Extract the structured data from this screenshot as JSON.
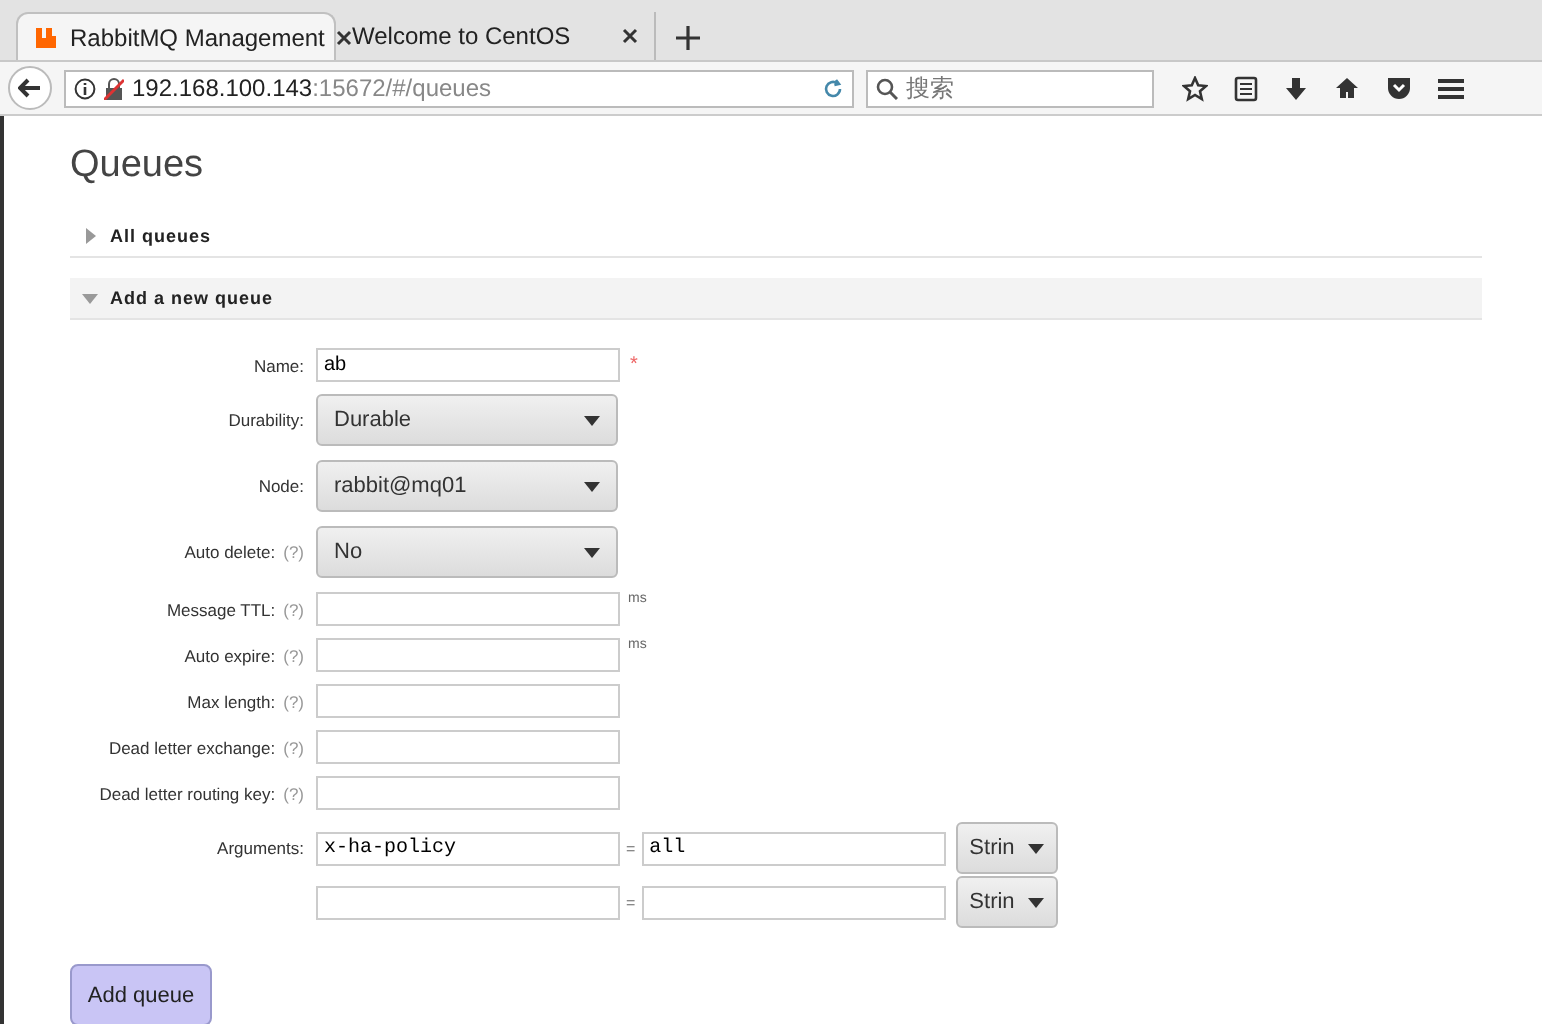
{
  "browser": {
    "tabs": [
      {
        "title": "RabbitMQ Management",
        "selected": true,
        "kind": "rabbit"
      },
      {
        "title": "Welcome to CentOS",
        "selected": false,
        "kind": "plain"
      }
    ],
    "url": {
      "host": "192.168.100.143",
      "rest": ":15672/#/queues"
    },
    "search": {
      "placeholder": "搜索"
    }
  },
  "page": {
    "title": "Queues",
    "sections": [
      {
        "label": "All queues",
        "expanded": false
      },
      {
        "label": "Add a new queue",
        "expanded": true
      }
    ],
    "fields": [
      {
        "kind": "text",
        "label": "Name:",
        "value": "ab",
        "required": true,
        "required_mark": "*"
      },
      {
        "kind": "select",
        "label": "Durability:",
        "value": "Durable"
      },
      {
        "kind": "select",
        "label": "Node:",
        "value": "rabbit@mq01"
      },
      {
        "kind": "select",
        "label": "Auto delete:",
        "help": "(?)",
        "value": "No"
      },
      {
        "kind": "text",
        "label": "Message TTL:",
        "help": "(?)",
        "unit": "ms"
      },
      {
        "kind": "text",
        "label": "Auto expire:",
        "help": "(?)",
        "unit": "ms"
      },
      {
        "kind": "text",
        "label": "Max length:",
        "help": "(?)"
      },
      {
        "kind": "text",
        "label": "Dead letter exchange:",
        "help": "(?)"
      },
      {
        "kind": "text",
        "label": "Dead letter routing key:",
        "help": "(?)"
      }
    ],
    "arguments": {
      "label": "Arguments:",
      "rows": [
        {
          "key": "x-ha-policy",
          "equals": "=",
          "value": "all",
          "type": "Strin"
        },
        {
          "equals": "=",
          "type": "Strin"
        }
      ]
    },
    "submit": "Add queue"
  }
}
